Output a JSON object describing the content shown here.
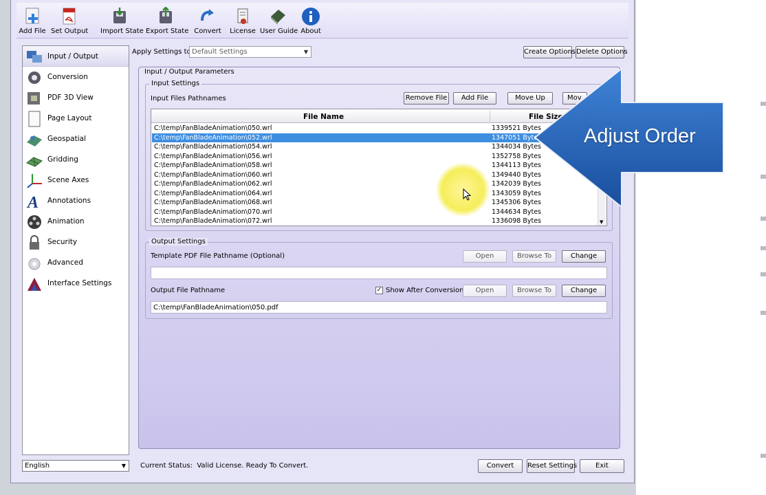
{
  "toolbar": {
    "items": [
      {
        "label": "Add File",
        "icon": "add-file-icon"
      },
      {
        "label": "Set Output",
        "icon": "pdf-output-icon"
      },
      {
        "label": "Import State",
        "icon": "import-state-icon"
      },
      {
        "label": "Export State",
        "icon": "export-state-icon"
      },
      {
        "label": "Convert",
        "icon": "convert-arrow-icon"
      },
      {
        "label": "License",
        "icon": "license-icon"
      },
      {
        "label": "User Guide",
        "icon": "user-guide-book-icon"
      },
      {
        "label": "About",
        "icon": "info-icon"
      }
    ]
  },
  "sidebar": {
    "items": [
      {
        "label": "Input / Output",
        "icon": "input-output-icon",
        "active": true
      },
      {
        "label": "Conversion",
        "icon": "conversion-gear-icon"
      },
      {
        "label": "PDF 3D View",
        "icon": "pdf-3d-view-icon"
      },
      {
        "label": "Page Layout",
        "icon": "page-layout-icon"
      },
      {
        "label": "Geospatial",
        "icon": "geospatial-icon"
      },
      {
        "label": "Gridding",
        "icon": "gridding-icon"
      },
      {
        "label": "Scene Axes",
        "icon": "scene-axes-icon"
      },
      {
        "label": "Annotations",
        "icon": "annotations-icon"
      },
      {
        "label": "Animation",
        "icon": "animation-film-icon"
      },
      {
        "label": "Security",
        "icon": "security-lock-icon"
      },
      {
        "label": "Advanced",
        "icon": "advanced-icon"
      },
      {
        "label": "Interface Settings",
        "icon": "interface-settings-icon"
      }
    ],
    "language": "English"
  },
  "apply": {
    "label": "Apply Settings to:",
    "value": "Default Settings",
    "create_label": "Create Options",
    "delete_label": "Delete Options"
  },
  "io": {
    "section_title": "Input / Output Parameters",
    "input": {
      "title": "Input Settings",
      "files_label": "Input Files Pathnames",
      "remove_label": "Remove File",
      "add_label": "Add File",
      "move_up_label": "Move Up",
      "move_down_label": "Mov",
      "col_name": "File Name",
      "col_size": "File Size",
      "files": [
        {
          "name": "C:\\temp\\FanBladeAnimation\\050.wrl",
          "size": "1339521 Bytes"
        },
        {
          "name": "C:\\temp\\FanBladeAnimation\\052.wrl",
          "size": "1347051 Bytes",
          "selected": true
        },
        {
          "name": "C:\\temp\\FanBladeAnimation\\054.wrl",
          "size": "1344034 Bytes"
        },
        {
          "name": "C:\\temp\\FanBladeAnimation\\056.wrl",
          "size": "1352758 Bytes"
        },
        {
          "name": "C:\\temp\\FanBladeAnimation\\058.wrl",
          "size": "1344113 Bytes"
        },
        {
          "name": "C:\\temp\\FanBladeAnimation\\060.wrl",
          "size": "1349440 Bytes"
        },
        {
          "name": "C:\\temp\\FanBladeAnimation\\062.wrl",
          "size": "1342039 Bytes"
        },
        {
          "name": "C:\\temp\\FanBladeAnimation\\064.wrl",
          "size": "1343059 Bytes"
        },
        {
          "name": "C:\\temp\\FanBladeAnimation\\068.wrl",
          "size": "1345306 Bytes"
        },
        {
          "name": "C:\\temp\\FanBladeAnimation\\070.wrl",
          "size": "1344634 Bytes"
        },
        {
          "name": "C:\\temp\\FanBladeAnimation\\072.wrl",
          "size": "1336098 Bytes"
        }
      ]
    },
    "output": {
      "title": "Output Settings",
      "template_label": "Template PDF File Pathname (Optional)",
      "template_value": "",
      "output_label": "Output File Pathname",
      "output_value": "C:\\temp\\FanBladeAnimation\\050.pdf",
      "show_after_label": "Show After Conversion",
      "show_after_checked": true,
      "open_label": "Open",
      "browse_label": "Browse To",
      "change_label": "Change"
    }
  },
  "footer": {
    "status_label": "Current Status:",
    "status_text": "Valid License. Ready To Convert.",
    "convert_label": "Convert",
    "reset_label": "Reset Settings",
    "exit_label": "Exit"
  },
  "callout": {
    "text": "Adjust Order",
    "color": "#1f5fb5"
  }
}
